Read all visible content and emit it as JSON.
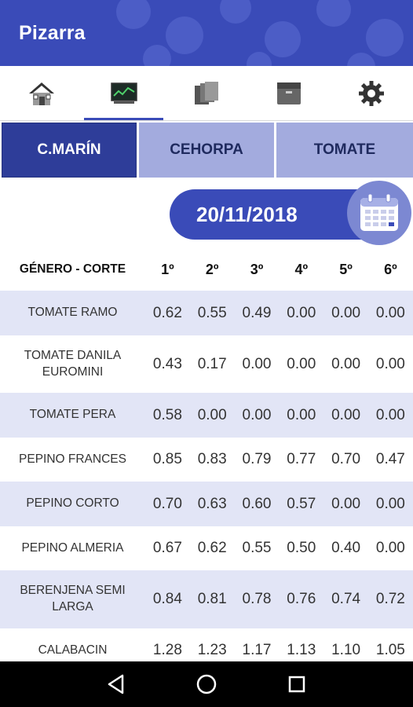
{
  "app": {
    "title": "Pizarra"
  },
  "tabs": [
    {
      "icon": "home-icon"
    },
    {
      "icon": "chart-icon",
      "active": true
    },
    {
      "icon": "documents-icon"
    },
    {
      "icon": "archive-icon"
    },
    {
      "icon": "gear-icon"
    }
  ],
  "markets": [
    {
      "label": "C.MARÍN",
      "active": true
    },
    {
      "label": "CEHORPA"
    },
    {
      "label": "TOMATE"
    }
  ],
  "date": "20/11/2018",
  "table": {
    "header_label": "GÉNERO - CORTE",
    "columns": [
      "1º",
      "2º",
      "3º",
      "4º",
      "5º",
      "6º"
    ],
    "rows": [
      {
        "name": "TOMATE RAMO",
        "values": [
          "0.62",
          "0.55",
          "0.49",
          "0.00",
          "0.00",
          "0.00"
        ]
      },
      {
        "name": "TOMATE DANILA EUROMINI",
        "values": [
          "0.43",
          "0.17",
          "0.00",
          "0.00",
          "0.00",
          "0.00"
        ]
      },
      {
        "name": "TOMATE PERA",
        "values": [
          "0.58",
          "0.00",
          "0.00",
          "0.00",
          "0.00",
          "0.00"
        ]
      },
      {
        "name": "PEPINO FRANCES",
        "values": [
          "0.85",
          "0.83",
          "0.79",
          "0.77",
          "0.70",
          "0.47"
        ]
      },
      {
        "name": "PEPINO CORTO",
        "values": [
          "0.70",
          "0.63",
          "0.60",
          "0.57",
          "0.00",
          "0.00"
        ]
      },
      {
        "name": "PEPINO ALMERIA",
        "values": [
          "0.67",
          "0.62",
          "0.55",
          "0.50",
          "0.40",
          "0.00"
        ]
      },
      {
        "name": "BERENJENA SEMI LARGA",
        "values": [
          "0.84",
          "0.81",
          "0.78",
          "0.76",
          "0.74",
          "0.72"
        ]
      },
      {
        "name": "CALABACIN",
        "values": [
          "1.28",
          "1.23",
          "1.17",
          "1.13",
          "1.10",
          "1.05"
        ]
      }
    ]
  },
  "colors": {
    "primary": "#3a4bb8",
    "primary_dark": "#2e3d99",
    "tab_inactive": "#a3abde",
    "row_stripe": "#e2e5f6"
  }
}
